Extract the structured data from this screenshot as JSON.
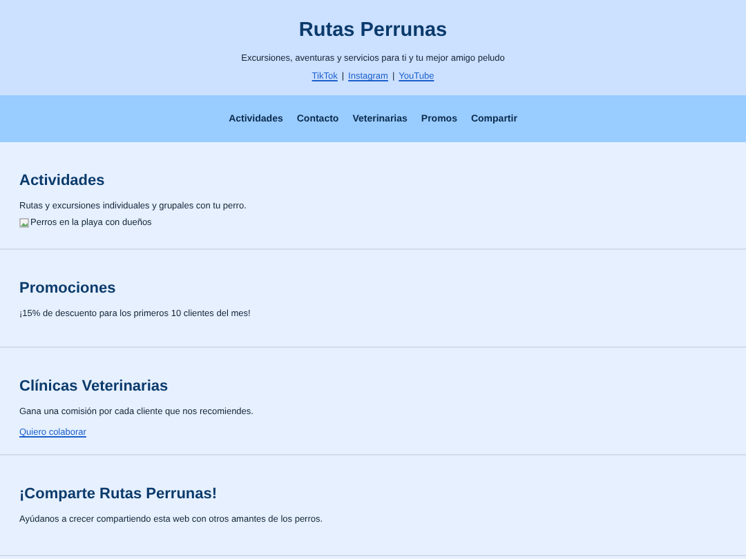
{
  "header": {
    "title": "Rutas Perrunas",
    "tagline": "Excursiones, aventuras y servicios para ti y tu mejor amigo peludo",
    "social_links": [
      "TikTok",
      "Instagram",
      "YouTube"
    ],
    "separator": "|"
  },
  "nav": [
    "Actividades",
    "Contacto",
    "Veterinarias",
    "Promos",
    "Compartir"
  ],
  "sections": [
    {
      "heading": "Actividades",
      "text": "Rutas y excursiones individuales y grupales con tu perro.",
      "image": {
        "kind": "picture",
        "alt": "Perros en la playa con dueños"
      }
    },
    {
      "heading": "Promociones",
      "text": "¡15% de descuento para los primeros 10 clientes del mes!"
    },
    {
      "heading": "Clínicas Veterinarias",
      "text": "Gana una comisión por cada cliente que nos recomiendes.",
      "link": "Quiero colaborar"
    },
    {
      "heading": "¡Comparte Rutas Perrunas!",
      "text": "Ayúdanos a crecer compartiendo esta web con otros amantes de los perros."
    }
  ]
}
